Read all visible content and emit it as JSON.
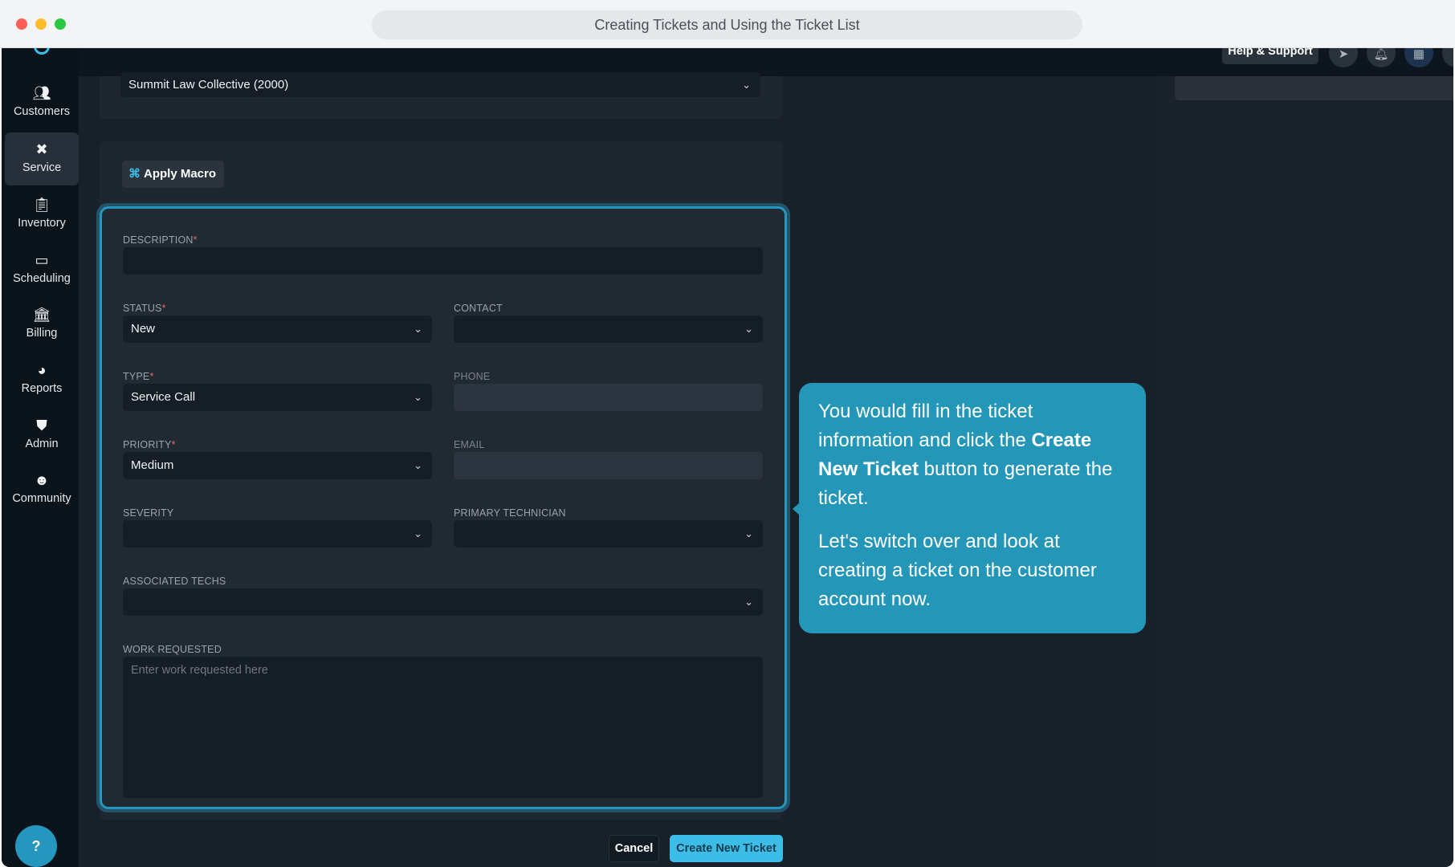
{
  "window": {
    "title": "Creating Tickets and Using the Ticket List"
  },
  "topbar": {
    "help_label": "Help & Support"
  },
  "sidebar": {
    "items": [
      {
        "label": "Customers",
        "icon": "users-icon"
      },
      {
        "label": "Service",
        "icon": "tools-icon"
      },
      {
        "label": "Inventory",
        "icon": "clipboard-check-icon"
      },
      {
        "label": "Scheduling",
        "icon": "calendar-icon"
      },
      {
        "label": "Billing",
        "icon": "bank-icon"
      },
      {
        "label": "Reports",
        "icon": "pie-chart-icon"
      },
      {
        "label": "Admin",
        "icon": "shield-user-icon"
      },
      {
        "label": "Community",
        "icon": "community-icon"
      }
    ],
    "help_button": "?"
  },
  "form": {
    "customer": "Summit Law Collective (2000)",
    "apply_macro": "Apply Macro",
    "description_label": "DESCRIPTION",
    "description_value": "",
    "status_label": "STATUS",
    "status_value": "New",
    "contact_label": "CONTACT",
    "contact_value": "",
    "type_label": "TYPE",
    "type_value": "Service Call",
    "phone_label": "PHONE",
    "priority_label": "PRIORITY",
    "priority_value": "Medium",
    "email_label": "EMAIL",
    "severity_label": "SEVERITY",
    "severity_value": "",
    "primary_tech_label": "PRIMARY TECHNICIAN",
    "primary_tech_value": "",
    "assoc_techs_label": "ASSOCIATED TECHS",
    "work_requested_label": "WORK REQUESTED",
    "work_requested_placeholder": "Enter work requested here",
    "required_mark": "*",
    "cancel": "Cancel",
    "create": "Create New Ticket"
  },
  "tooltip": {
    "p1_a": "You would fill in the ticket information and click the ",
    "p1_bold": "Create New Ticket",
    "p1_b": " button to generate the ticket.",
    "p2": "Let's switch over and look at creating a ticket on the customer account now."
  },
  "colors": {
    "accent": "#2497b8",
    "primary_button": "#3bbde8"
  }
}
